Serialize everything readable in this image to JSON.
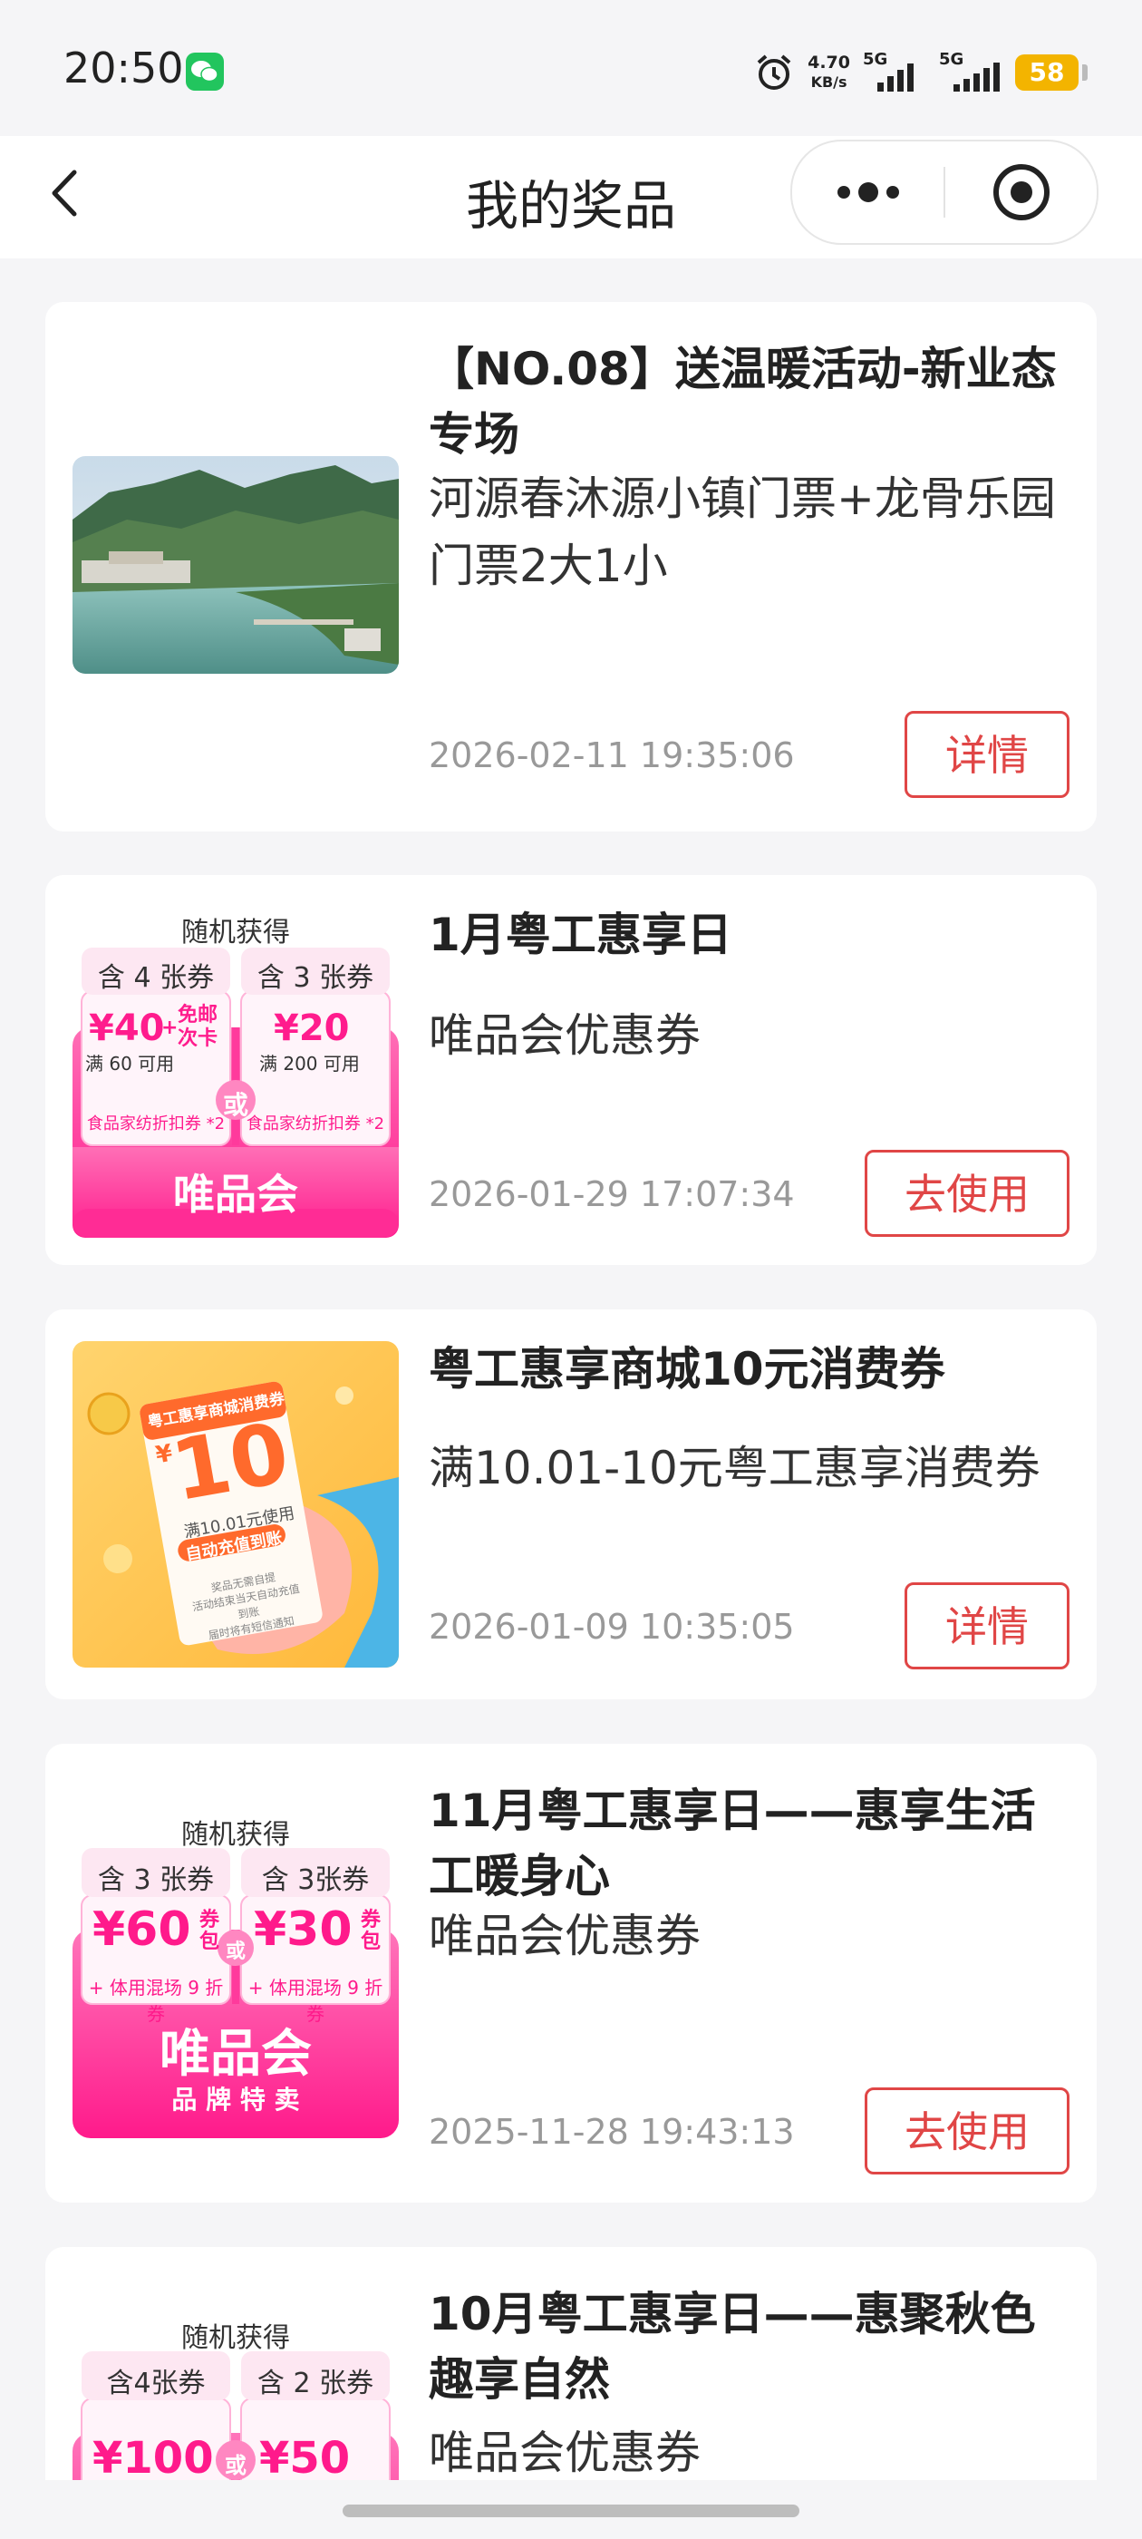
{
  "status": {
    "time": "20:50",
    "speed_value": "4.70",
    "speed_unit": "KB/s",
    "net1": "5G",
    "net2": "5G",
    "battery": "58"
  },
  "nav": {
    "title": "我的奖品"
  },
  "prizes": [
    {
      "title": "【NO.08】送温暖活动-新业态专场",
      "desc": "河源春沐源小镇门票+龙骨乐园门票2大1小",
      "date": "2026-02-11 19:35:06",
      "button": "详情",
      "thumb": "resort-lake-photo"
    },
    {
      "title": "1月粤工惠享日",
      "desc": "唯品会优惠券",
      "date": "2026-01-29 17:07:34",
      "button": "去使用",
      "thumb": {
        "top_text": "随机获得",
        "tag_left": "含 4 张券",
        "tag_right": "含 3 张券",
        "left_amount": "¥40",
        "left_plus": "+",
        "left_extra": "免邮次卡",
        "left_cond": "满 60 可用",
        "right_amount": "¥20",
        "right_cond": "满 200 可用",
        "left_bottom": "食品家纺折扣券 *2",
        "right_bottom": "食品家纺折扣券 *2",
        "or": "或",
        "brand": "唯品会"
      }
    },
    {
      "title": "粤工惠享商城10元消费券",
      "desc": "满10.01-10元粤工惠享消费券",
      "date": "2026-01-09 10:35:05",
      "button": "详情",
      "thumb": {
        "header": "粤工惠享商城消费券",
        "amount": "10",
        "currency": "¥",
        "cond": "满10.01元使用",
        "badge": "自动充值到账",
        "note1": "奖品无需自提",
        "note2": "活动结束当天自动充值到账",
        "note3": "届时将有短信通知"
      }
    },
    {
      "title": "11月粤工惠享日——惠享生活工暖身心",
      "desc": "唯品会优惠券",
      "date": "2025-11-28 19:43:13",
      "button": "去使用",
      "thumb": {
        "top_text": "随机获得",
        "tag_left": "含 3 张券",
        "tag_right": "含 3张券",
        "left_amount": "¥60",
        "left_unit": "券包",
        "right_amount": "¥30",
        "right_unit": "券包",
        "left_bottom": "+ 体用混场 9 折券",
        "right_bottom": "+ 体用混场 9 折券",
        "or": "或",
        "brand": "唯品会",
        "brand_sub": "品 牌 特 卖"
      }
    },
    {
      "title": "10月粤工惠享日——惠聚秋色趣享自然",
      "desc": "唯品会优惠券",
      "thumb": {
        "top_text": "随机获得",
        "tag_left": "含4张券",
        "tag_right": "含 2 张券",
        "left_amount": "¥100",
        "right_amount": "¥50",
        "or": "或"
      }
    }
  ]
}
